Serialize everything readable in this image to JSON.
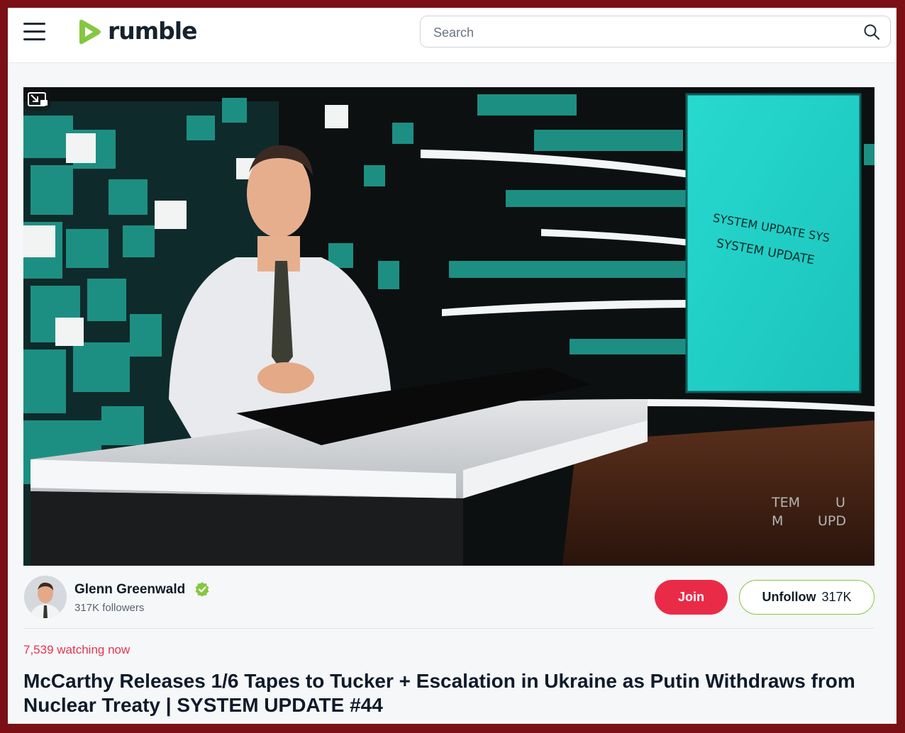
{
  "header": {
    "logo_text": "rumble",
    "search_placeholder": "Search"
  },
  "video": {
    "screen_text_line1": "SYSTEM UPDATE SYS",
    "screen_text_line2": "SYSTEM UPDATE",
    "watermark_line1": "TEM",
    "watermark_line1b": "U",
    "watermark_line2": "M",
    "watermark_line2b": "UPD"
  },
  "channel": {
    "name": "Glenn Greenwald",
    "followers": "317K followers",
    "join_label": "Join",
    "unfollow_label": "Unfollow",
    "unfollow_count": "317K"
  },
  "stream": {
    "watching": "7,539 watching now",
    "title": "McCarthy Releases 1/6 Tapes to Tucker + Escalation in Ukraine as Putin Withdraws from Nuclear Treaty | SYSTEM UPDATE #44"
  },
  "colors": {
    "brand_green": "#85c742",
    "join_red": "#ea2b48",
    "frame": "#7a1016"
  }
}
